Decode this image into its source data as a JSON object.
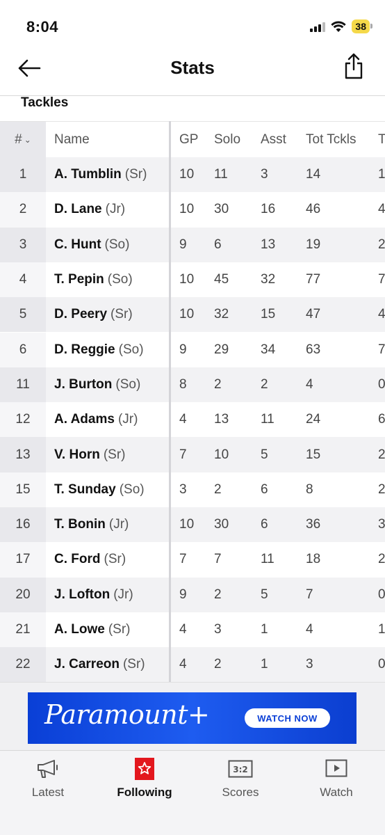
{
  "status_bar": {
    "time": "8:04",
    "battery": "38",
    "battery_color": "#f5d94a"
  },
  "nav": {
    "title": "Stats",
    "back_icon": "arrow-left-icon",
    "share_icon": "share-icon"
  },
  "section_title": "Tackles",
  "table": {
    "headers": {
      "num": "#",
      "name": "Name",
      "gp": "GP",
      "solo": "Solo",
      "asst": "Asst",
      "tot": "Tot Tckls",
      "t": "T"
    },
    "rows": [
      {
        "num": "1",
        "name": "A. Tumblin",
        "year": "(Sr)",
        "gp": "10",
        "solo": "11",
        "asst": "3",
        "tot": "14",
        "t": "1"
      },
      {
        "num": "2",
        "name": "D. Lane",
        "year": "(Jr)",
        "gp": "10",
        "solo": "30",
        "asst": "16",
        "tot": "46",
        "t": "4"
      },
      {
        "num": "3",
        "name": "C. Hunt",
        "year": "(So)",
        "gp": "9",
        "solo": "6",
        "asst": "13",
        "tot": "19",
        "t": "2"
      },
      {
        "num": "4",
        "name": "T. Pepin",
        "year": "(So)",
        "gp": "10",
        "solo": "45",
        "asst": "32",
        "tot": "77",
        "t": "7"
      },
      {
        "num": "5",
        "name": "D. Peery",
        "year": "(Sr)",
        "gp": "10",
        "solo": "32",
        "asst": "15",
        "tot": "47",
        "t": "4"
      },
      {
        "num": "6",
        "name": "D. Reggie",
        "year": "(So)",
        "gp": "9",
        "solo": "29",
        "asst": "34",
        "tot": "63",
        "t": "7"
      },
      {
        "num": "11",
        "name": "J. Burton",
        "year": "(So)",
        "gp": "8",
        "solo": "2",
        "asst": "2",
        "tot": "4",
        "t": "0"
      },
      {
        "num": "12",
        "name": "A. Adams",
        "year": "(Jr)",
        "gp": "4",
        "solo": "13",
        "asst": "11",
        "tot": "24",
        "t": "6"
      },
      {
        "num": "13",
        "name": "V. Horn",
        "year": "(Sr)",
        "gp": "7",
        "solo": "10",
        "asst": "5",
        "tot": "15",
        "t": "2"
      },
      {
        "num": "15",
        "name": "T. Sunday",
        "year": "(So)",
        "gp": "3",
        "solo": "2",
        "asst": "6",
        "tot": "8",
        "t": "2"
      },
      {
        "num": "16",
        "name": "T. Bonin",
        "year": "(Jr)",
        "gp": "10",
        "solo": "30",
        "asst": "6",
        "tot": "36",
        "t": "3"
      },
      {
        "num": "17",
        "name": "C. Ford",
        "year": "(Sr)",
        "gp": "7",
        "solo": "7",
        "asst": "11",
        "tot": "18",
        "t": "2"
      },
      {
        "num": "20",
        "name": "J. Lofton",
        "year": "(Jr)",
        "gp": "9",
        "solo": "2",
        "asst": "5",
        "tot": "7",
        "t": "0"
      },
      {
        "num": "21",
        "name": "A. Lowe",
        "year": "(Sr)",
        "gp": "4",
        "solo": "3",
        "asst": "1",
        "tot": "4",
        "t": "1"
      },
      {
        "num": "22",
        "name": "J. Carreon",
        "year": "(Sr)",
        "gp": "4",
        "solo": "2",
        "asst": "1",
        "tot": "3",
        "t": "0"
      }
    ]
  },
  "ad": {
    "brand": "Paramount+",
    "cta": "WATCH NOW",
    "bg_color": "#0a3fd6"
  },
  "tab_bar": {
    "tabs": [
      {
        "label": "Latest",
        "icon": "megaphone-icon"
      },
      {
        "label": "Following",
        "icon": "star-icon",
        "active": true
      },
      {
        "label": "Scores",
        "icon": "scoreboard-icon"
      },
      {
        "label": "Watch",
        "icon": "play-icon"
      }
    ],
    "accent_color": "#e3171e"
  }
}
